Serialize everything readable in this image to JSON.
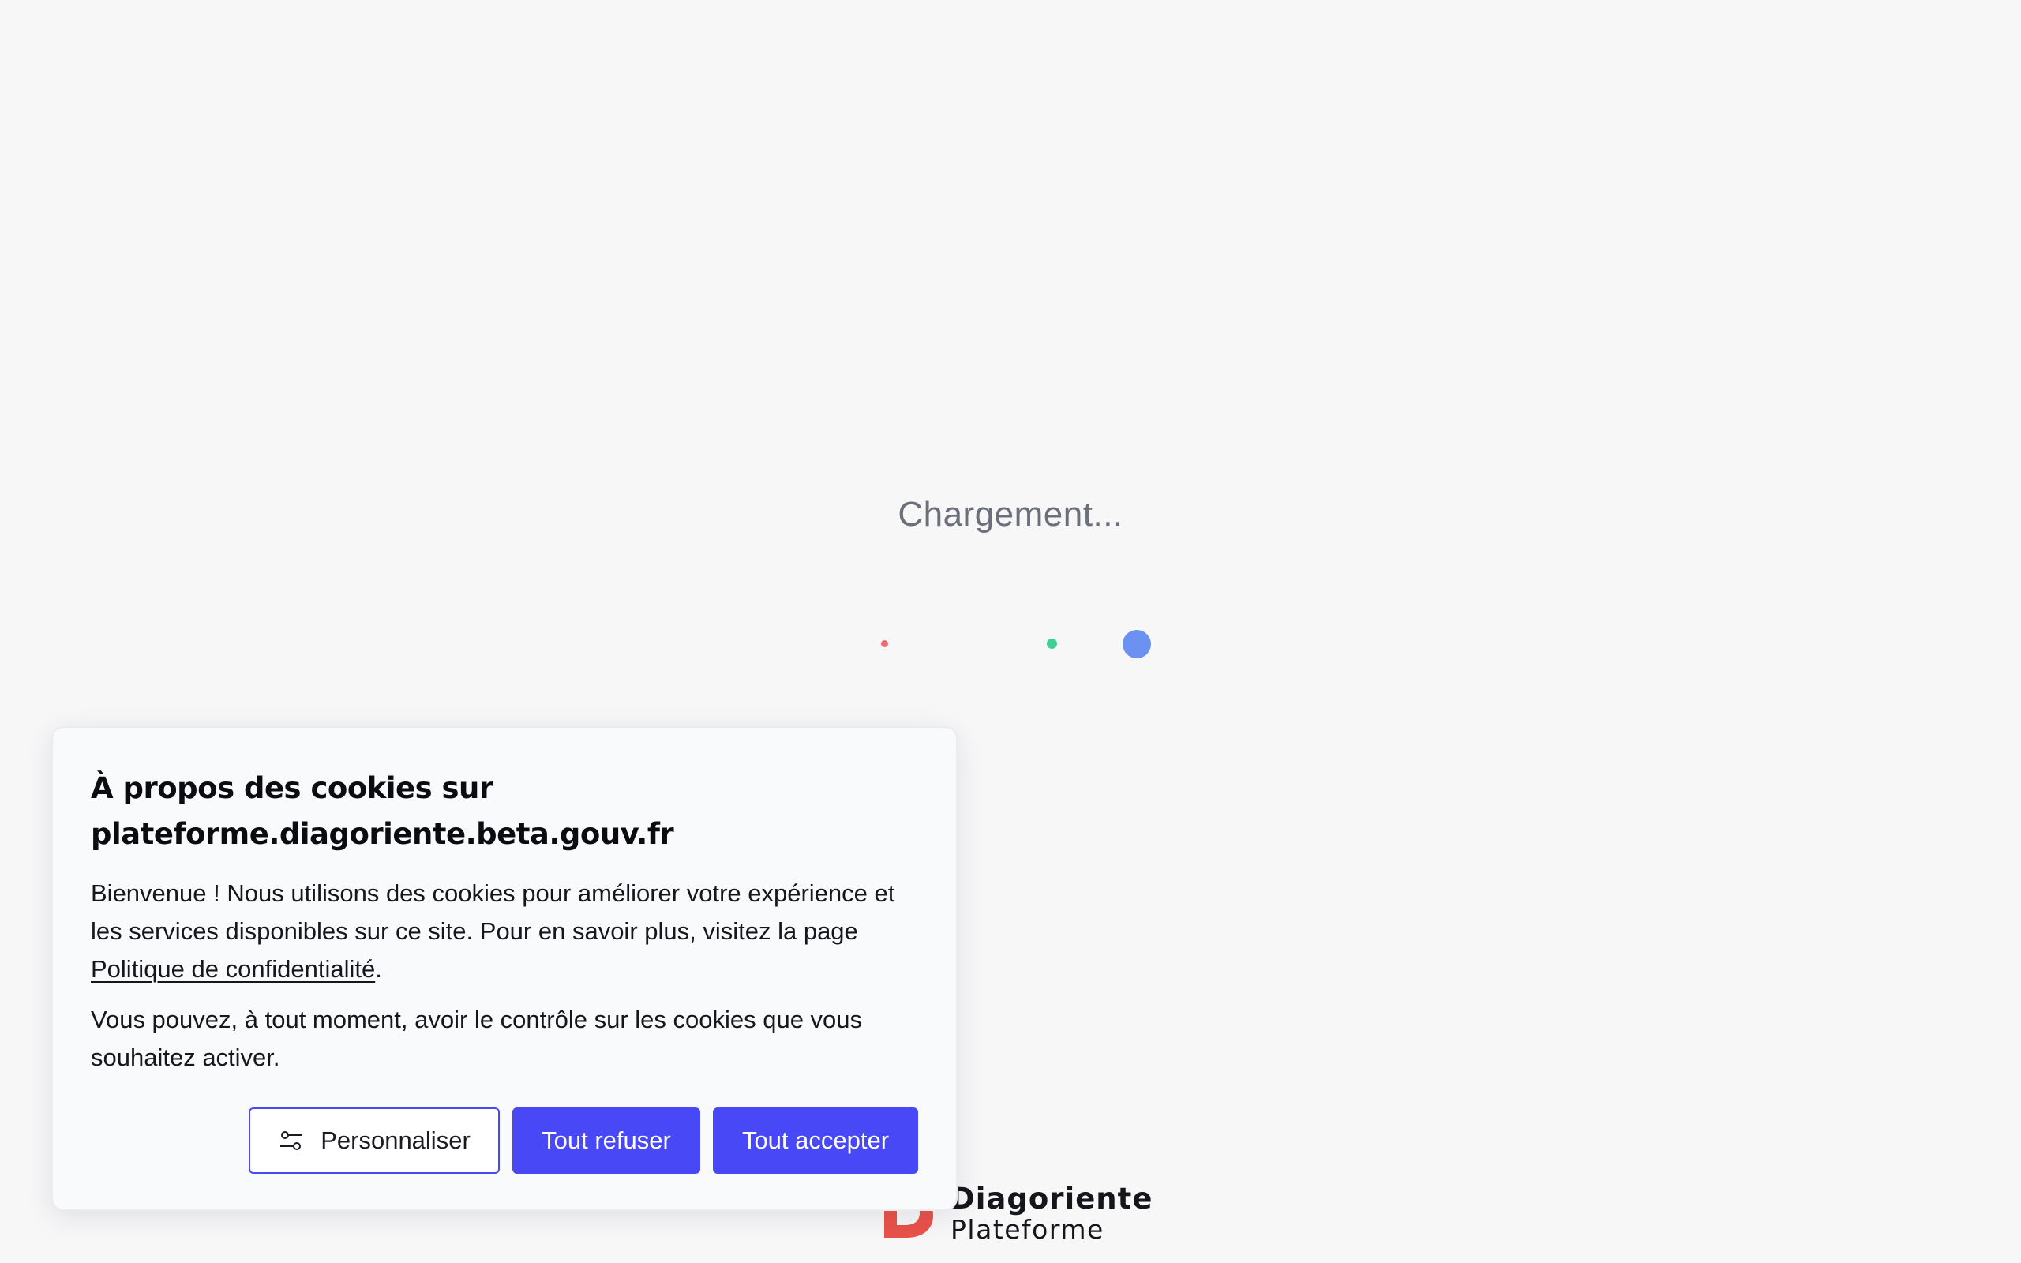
{
  "loading": {
    "text": "Chargement..."
  },
  "colors": {
    "dot_red": "#f06a72",
    "dot_green": "#3fcf95",
    "dot_blue": "#6b92f2",
    "logo_red": "#e9524a",
    "primary": "#4848f7"
  },
  "logo": {
    "name": "Diagoriente",
    "subtitle": "Plateforme",
    "icon": "diagoriente-d-logo-icon"
  },
  "cookie_banner": {
    "title_line1": "À propos des cookies sur",
    "title_line2": "plateforme.diagoriente.beta.gouv.fr",
    "intro_text": "Bienvenue ! Nous utilisons des cookies pour améliorer votre expérience et les services disponibles sur ce site. Pour en savoir plus, visitez la page",
    "policy_link": "Politique de confidentialité",
    "intro_suffix": ".",
    "control_text": "Vous pouvez, à tout moment, avoir le contrôle sur les cookies que vous souhaitez activer.",
    "buttons": {
      "customize": "Personnaliser",
      "customize_icon": "sliders-icon",
      "refuse_all": "Tout refuser",
      "accept_all": "Tout accepter"
    }
  }
}
